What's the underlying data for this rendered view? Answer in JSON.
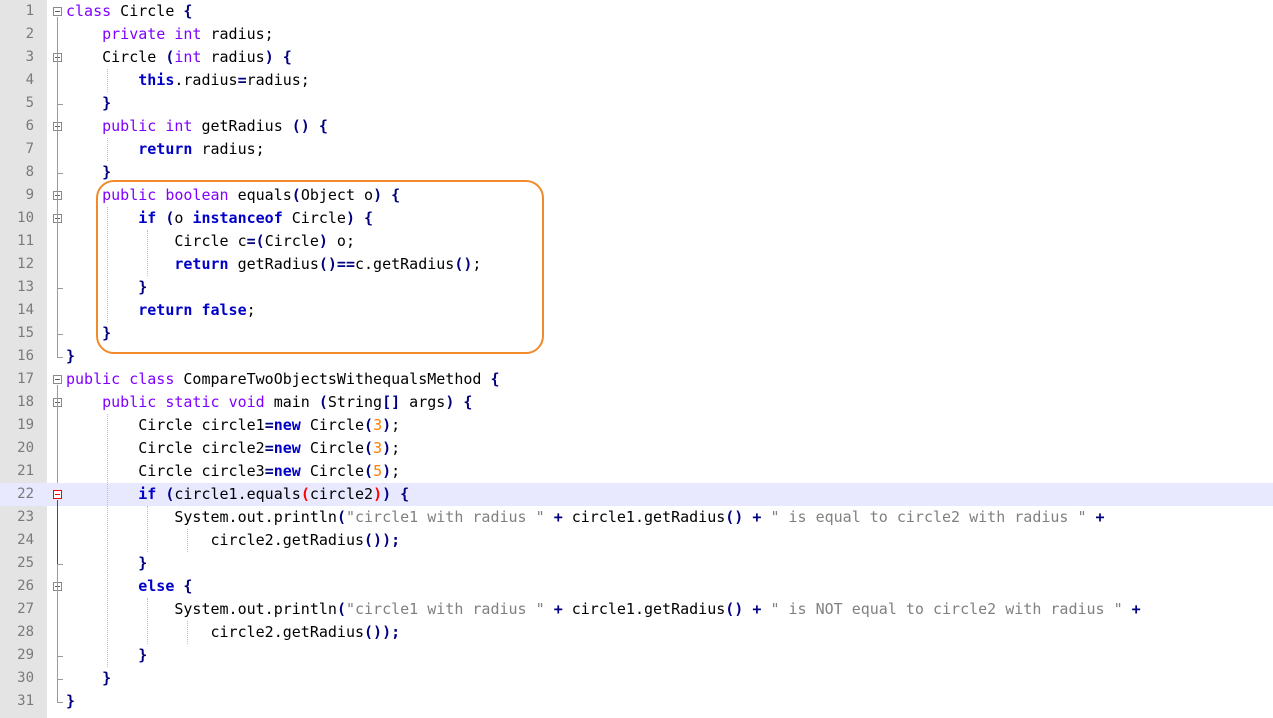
{
  "editor": {
    "current_line": 22,
    "highlight_color": "#f08a2a",
    "lines": [
      {
        "n": "1",
        "tokens": [
          {
            "t": "class",
            "c": "kw"
          },
          {
            "t": " Circle "
          },
          {
            "t": "{",
            "c": "op"
          }
        ]
      },
      {
        "n": "2",
        "tokens": [
          {
            "t": "    "
          },
          {
            "t": "private",
            "c": "kw"
          },
          {
            "t": " "
          },
          {
            "t": "int",
            "c": "kw"
          },
          {
            "t": " radius;"
          }
        ]
      },
      {
        "n": "3",
        "tokens": [
          {
            "t": "    Circle "
          },
          {
            "t": "(",
            "c": "op"
          },
          {
            "t": "int",
            "c": "kw"
          },
          {
            "t": " radius"
          },
          {
            "t": ")",
            "c": "op"
          },
          {
            "t": " "
          },
          {
            "t": "{",
            "c": "op"
          }
        ]
      },
      {
        "n": "4",
        "tokens": [
          {
            "t": "        "
          },
          {
            "t": "this",
            "c": "kwb"
          },
          {
            "t": ".radius"
          },
          {
            "t": "=",
            "c": "op"
          },
          {
            "t": "radius;"
          }
        ]
      },
      {
        "n": "5",
        "tokens": [
          {
            "t": "    "
          },
          {
            "t": "}",
            "c": "op"
          }
        ]
      },
      {
        "n": "6",
        "tokens": [
          {
            "t": "    "
          },
          {
            "t": "public",
            "c": "kw"
          },
          {
            "t": " "
          },
          {
            "t": "int",
            "c": "kw"
          },
          {
            "t": " getRadius "
          },
          {
            "t": "()",
            "c": "op"
          },
          {
            "t": " "
          },
          {
            "t": "{",
            "c": "op"
          }
        ]
      },
      {
        "n": "7",
        "tokens": [
          {
            "t": "        "
          },
          {
            "t": "return",
            "c": "kwb"
          },
          {
            "t": " radius;"
          }
        ]
      },
      {
        "n": "8",
        "tokens": [
          {
            "t": "    "
          },
          {
            "t": "}",
            "c": "op"
          }
        ]
      },
      {
        "n": "9",
        "tokens": [
          {
            "t": "    "
          },
          {
            "t": "public",
            "c": "kw"
          },
          {
            "t": " "
          },
          {
            "t": "boolean",
            "c": "kw"
          },
          {
            "t": " equals"
          },
          {
            "t": "(",
            "c": "op"
          },
          {
            "t": "Object o"
          },
          {
            "t": ")",
            "c": "op"
          },
          {
            "t": " "
          },
          {
            "t": "{",
            "c": "op"
          }
        ]
      },
      {
        "n": "10",
        "tokens": [
          {
            "t": "        "
          },
          {
            "t": "if",
            "c": "kwb"
          },
          {
            "t": " "
          },
          {
            "t": "(",
            "c": "op"
          },
          {
            "t": "o "
          },
          {
            "t": "instanceof",
            "c": "kwb"
          },
          {
            "t": " Circle"
          },
          {
            "t": ")",
            "c": "op"
          },
          {
            "t": " "
          },
          {
            "t": "{",
            "c": "op"
          }
        ]
      },
      {
        "n": "11",
        "tokens": [
          {
            "t": "            Circle c"
          },
          {
            "t": "=(",
            "c": "op"
          },
          {
            "t": "Circle"
          },
          {
            "t": ")",
            "c": "op"
          },
          {
            "t": " o;"
          }
        ]
      },
      {
        "n": "12",
        "tokens": [
          {
            "t": "            "
          },
          {
            "t": "return",
            "c": "kwb"
          },
          {
            "t": " getRadius"
          },
          {
            "t": "()==",
            "c": "op"
          },
          {
            "t": "c.getRadius"
          },
          {
            "t": "()",
            "c": "op"
          },
          {
            "t": ";"
          }
        ]
      },
      {
        "n": "13",
        "tokens": [
          {
            "t": "        "
          },
          {
            "t": "}",
            "c": "op"
          }
        ]
      },
      {
        "n": "14",
        "tokens": [
          {
            "t": "        "
          },
          {
            "t": "return",
            "c": "kwb"
          },
          {
            "t": " "
          },
          {
            "t": "false",
            "c": "kwb"
          },
          {
            "t": ";"
          }
        ]
      },
      {
        "n": "15",
        "tokens": [
          {
            "t": "    "
          },
          {
            "t": "}",
            "c": "op"
          }
        ]
      },
      {
        "n": "16",
        "tokens": [
          {
            "t": "}",
            "c": "op"
          }
        ]
      },
      {
        "n": "17",
        "tokens": [
          {
            "t": "public",
            "c": "kw"
          },
          {
            "t": " "
          },
          {
            "t": "class",
            "c": "kw"
          },
          {
            "t": " CompareTwoObjectsWithequalsMethod "
          },
          {
            "t": "{",
            "c": "op"
          }
        ]
      },
      {
        "n": "18",
        "tokens": [
          {
            "t": "    "
          },
          {
            "t": "public",
            "c": "kw"
          },
          {
            "t": " "
          },
          {
            "t": "static",
            "c": "kw"
          },
          {
            "t": " "
          },
          {
            "t": "void",
            "c": "kw"
          },
          {
            "t": " main "
          },
          {
            "t": "(",
            "c": "op"
          },
          {
            "t": "String"
          },
          {
            "t": "[]",
            "c": "op"
          },
          {
            "t": " args"
          },
          {
            "t": ")",
            "c": "op"
          },
          {
            "t": " "
          },
          {
            "t": "{",
            "c": "op"
          }
        ]
      },
      {
        "n": "19",
        "tokens": [
          {
            "t": "        Circle circle1"
          },
          {
            "t": "=",
            "c": "op"
          },
          {
            "t": "new",
            "c": "kwb"
          },
          {
            "t": " Circle"
          },
          {
            "t": "(",
            "c": "op"
          },
          {
            "t": "3",
            "c": "num"
          },
          {
            "t": ")",
            "c": "op"
          },
          {
            "t": ";"
          }
        ]
      },
      {
        "n": "20",
        "tokens": [
          {
            "t": "        Circle circle2"
          },
          {
            "t": "=",
            "c": "op"
          },
          {
            "t": "new",
            "c": "kwb"
          },
          {
            "t": " Circle"
          },
          {
            "t": "(",
            "c": "op"
          },
          {
            "t": "3",
            "c": "num"
          },
          {
            "t": ")",
            "c": "op"
          },
          {
            "t": ";"
          }
        ]
      },
      {
        "n": "21",
        "tokens": [
          {
            "t": "        Circle circle3"
          },
          {
            "t": "=",
            "c": "op"
          },
          {
            "t": "new",
            "c": "kwb"
          },
          {
            "t": " Circle"
          },
          {
            "t": "(",
            "c": "op"
          },
          {
            "t": "5",
            "c": "num"
          },
          {
            "t": ")",
            "c": "op"
          },
          {
            "t": ";"
          }
        ]
      },
      {
        "n": "22",
        "tokens": [
          {
            "t": "        "
          },
          {
            "t": "if",
            "c": "kwb"
          },
          {
            "t": " "
          },
          {
            "t": "(",
            "c": "op"
          },
          {
            "t": "circle1.equals"
          },
          {
            "t": "(",
            "c": "brk"
          },
          {
            "t": "circle2"
          },
          {
            "t": ")",
            "c": "brk"
          },
          {
            "t": ")",
            "c": "op"
          },
          {
            "t": " "
          },
          {
            "t": "{",
            "c": "op"
          }
        ]
      },
      {
        "n": "23",
        "tokens": [
          {
            "t": "            System.out.println"
          },
          {
            "t": "(",
            "c": "op"
          },
          {
            "t": "\"circle1 with radius \"",
            "c": "str"
          },
          {
            "t": " "
          },
          {
            "t": "+",
            "c": "op"
          },
          {
            "t": " circle1.getRadius"
          },
          {
            "t": "()",
            "c": "op"
          },
          {
            "t": " "
          },
          {
            "t": "+",
            "c": "op"
          },
          {
            "t": " "
          },
          {
            "t": "\" is equal to circle2 with radius \"",
            "c": "str"
          },
          {
            "t": " "
          },
          {
            "t": "+",
            "c": "op"
          }
        ]
      },
      {
        "n": "24",
        "tokens": [
          {
            "t": "                circle2.getRadius"
          },
          {
            "t": "());",
            "c": "op"
          }
        ]
      },
      {
        "n": "25",
        "tokens": [
          {
            "t": "        "
          },
          {
            "t": "}",
            "c": "op"
          }
        ]
      },
      {
        "n": "26",
        "tokens": [
          {
            "t": "        "
          },
          {
            "t": "else",
            "c": "kwb"
          },
          {
            "t": " "
          },
          {
            "t": "{",
            "c": "op"
          }
        ]
      },
      {
        "n": "27",
        "tokens": [
          {
            "t": "            System.out.println"
          },
          {
            "t": "(",
            "c": "op"
          },
          {
            "t": "\"circle1 with radius \"",
            "c": "str"
          },
          {
            "t": " "
          },
          {
            "t": "+",
            "c": "op"
          },
          {
            "t": " circle1.getRadius"
          },
          {
            "t": "()",
            "c": "op"
          },
          {
            "t": " "
          },
          {
            "t": "+",
            "c": "op"
          },
          {
            "t": " "
          },
          {
            "t": "\" is NOT equal to circle2 with radius \"",
            "c": "str"
          },
          {
            "t": " "
          },
          {
            "t": "+",
            "c": "op"
          }
        ]
      },
      {
        "n": "28",
        "tokens": [
          {
            "t": "                circle2.getRadius"
          },
          {
            "t": "());",
            "c": "op"
          }
        ]
      },
      {
        "n": "29",
        "tokens": [
          {
            "t": "        "
          },
          {
            "t": "}",
            "c": "op"
          }
        ]
      },
      {
        "n": "30",
        "tokens": [
          {
            "t": "    "
          },
          {
            "t": "}",
            "c": "op"
          }
        ]
      },
      {
        "n": "31",
        "tokens": [
          {
            "t": "}",
            "c": "op"
          }
        ]
      }
    ]
  }
}
